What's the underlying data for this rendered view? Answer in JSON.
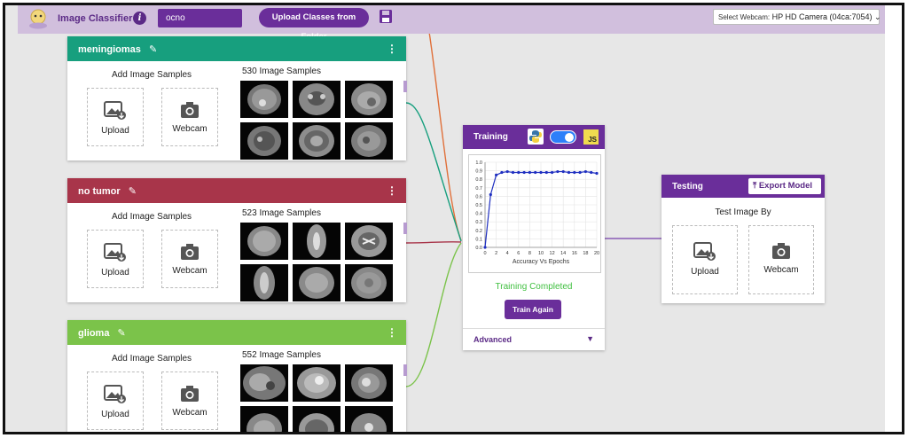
{
  "header": {
    "title": "Image Classifier",
    "info_icon": "info-icon",
    "project_name": "ocno",
    "upload_folder_label": "Upload Classes from Folder",
    "save_icon": "save-icon",
    "webcam_label": "Select Webcam:",
    "webcam_value": "HP HD Camera (04ca:7054)"
  },
  "classes": [
    {
      "name": "meningiomas",
      "color": "#179f7e",
      "add_label": "Add Image Samples",
      "sample_count": "530 Image Samples",
      "upload_label": "Upload",
      "webcam_label": "Webcam"
    },
    {
      "name": "no tumor",
      "color": "#a8354a",
      "add_label": "Add Image Samples",
      "sample_count": "523 Image Samples",
      "upload_label": "Upload",
      "webcam_label": "Webcam"
    },
    {
      "name": "glioma",
      "color": "#7bc34a",
      "add_label": "Add Image Samples",
      "sample_count": "552 Image Samples",
      "upload_label": "Upload",
      "webcam_label": "Webcam"
    }
  ],
  "training": {
    "title": "Training",
    "status": "Training Completed",
    "train_again_label": "Train Again",
    "advanced_label": "Advanced",
    "toggle_on": true,
    "js_label": "JS"
  },
  "testing": {
    "title": "Testing",
    "export_label": "Export Model",
    "test_by_label": "Test Image By",
    "upload_label": "Upload",
    "webcam_label": "Webcam"
  },
  "colors": {
    "accent": "#6a2e9a",
    "topbar": "#d1bfdd",
    "success": "#3fbf3f"
  },
  "chart_data": {
    "type": "line",
    "title": "",
    "xlabel": "Accuracy Vs Epochs",
    "ylabel": "",
    "xlim": [
      0,
      20
    ],
    "ylim": [
      0,
      1.0
    ],
    "x_ticks": [
      "0",
      "2",
      "4",
      "6",
      "8",
      "10",
      "12",
      "14",
      "16",
      "18",
      "20"
    ],
    "y_ticks": [
      "0.0",
      "0.1",
      "0.2",
      "0.3",
      "0.4",
      "0.5",
      "0.6",
      "0.7",
      "0.8",
      "0.9",
      "1.0"
    ],
    "series": [
      {
        "x": [
          0,
          1,
          2,
          3,
          4,
          5,
          6,
          7,
          8,
          9,
          10,
          11,
          12,
          13,
          14,
          15,
          16,
          17,
          18,
          19,
          20
        ],
        "values": [
          0.0,
          0.62,
          0.85,
          0.88,
          0.89,
          0.88,
          0.88,
          0.88,
          0.88,
          0.88,
          0.88,
          0.88,
          0.88,
          0.89,
          0.89,
          0.88,
          0.88,
          0.88,
          0.89,
          0.88,
          0.87
        ]
      }
    ]
  }
}
